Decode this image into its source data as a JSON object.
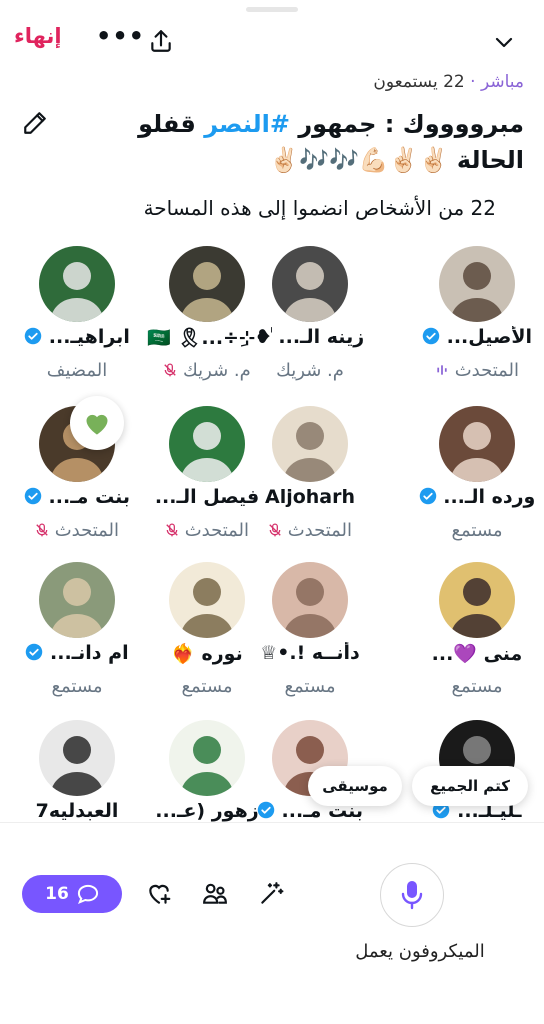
{
  "header": {
    "end_label": "إنهاء",
    "more_label": "•••"
  },
  "space": {
    "live_label": "مباشر",
    "separator": "·",
    "listeners": "22 يستمعون",
    "title_part1": "مبرووووك : جمهور ",
    "hashtag": "#النصر",
    "title_part2": " قفلو الحالة ✌🏻✌🏻💪🏻🎶🎶✌🏻",
    "joined_text": "22 من الأشخاص انضموا إلى هذه المساحة"
  },
  "participants": [
    {
      "name": "الأصيل...",
      "role": "المتحدث",
      "verified": true,
      "role_icon": "speaking"
    },
    {
      "name": "زينه الـ... ❥",
      "role": "م. شريك",
      "verified": false,
      "role_icon": "none"
    },
    {
      "name": "ٰ•⊹ِ÷...🎗",
      "role": "م. شريك",
      "verified": false,
      "role_icon": "mic-off",
      "flag": "🇸🇦"
    },
    {
      "name": "ابراهيـ...",
      "role": "المضيف",
      "verified": true,
      "role_icon": "none"
    },
    {
      "name": "ورده الـ...",
      "role": "مستمع",
      "verified": true,
      "role_icon": "none"
    },
    {
      "name": "Aljoharh",
      "role": "المتحدث",
      "verified": false,
      "role_icon": "mic-off"
    },
    {
      "name": "فيصل الـ...",
      "role": "المتحدث",
      "verified": false,
      "role_icon": "mic-off"
    },
    {
      "name": "بنت مـ...",
      "role": "المتحدث",
      "verified": true,
      "role_icon": "mic-off"
    },
    {
      "name": "منى 💜...",
      "role": "مستمع",
      "verified": false,
      "role_icon": "none"
    },
    {
      "name": "دأنــه !.•♕",
      "role": "مستمع",
      "verified": false,
      "role_icon": "none"
    },
    {
      "name": "نوره ❤️‍🔥",
      "role": "مستمع",
      "verified": false,
      "role_icon": "none"
    },
    {
      "name": "ام دانـ...",
      "role": "مستمع",
      "verified": true,
      "role_icon": "none"
    },
    {
      "name": "ـليـلـ...",
      "role": "",
      "verified": true,
      "role_icon": "none"
    },
    {
      "name": "بنت مـ...",
      "role": "",
      "verified": true,
      "role_icon": "none"
    },
    {
      "name": "زهور (عـ...",
      "role": "",
      "verified": false,
      "role_icon": "none"
    },
    {
      "name": "العبدليه7",
      "role": "",
      "verified": false,
      "role_icon": "none"
    }
  ],
  "popups": {
    "mute_all": "كتم الجميع",
    "music": "موسيقى"
  },
  "bottom_bar": {
    "chat_count": "16",
    "mic_status": "الميكروفون يعمل"
  },
  "colors": {
    "accent_red": "#e0245e",
    "accent_purple": "#7856ff",
    "hashtag_blue": "#1d9bf0",
    "verified_blue": "#1d9bf0",
    "muted_pink": "#d6336c",
    "speaking_purple": "#8a64d6"
  },
  "icons": [
    "share-icon",
    "chevron-down-icon",
    "edit-icon",
    "verified-icon",
    "mic-off-icon",
    "speaking-icon",
    "heart-icon",
    "chat-icon",
    "heart-add-icon",
    "people-icon",
    "magic-wand-icon",
    "microphone-icon"
  ]
}
